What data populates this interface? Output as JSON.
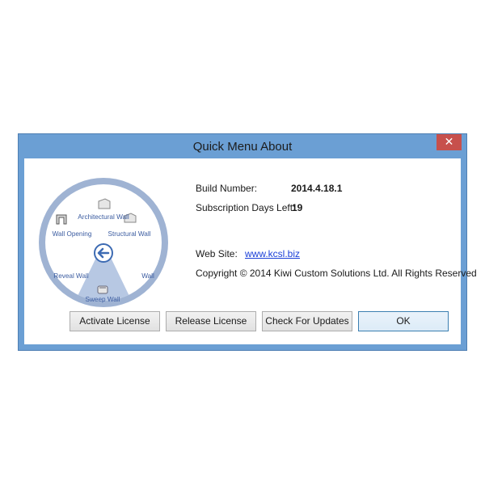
{
  "window": {
    "title": "Quick Menu About",
    "close_glyph": "✕"
  },
  "wheel": {
    "center_icon": "back-arrow-icon",
    "items": [
      {
        "label": "Architectural Wall",
        "icon": "wall-icon"
      },
      {
        "label": "Wall Opening",
        "icon": "wall-opening-icon"
      },
      {
        "label": "Structural Wall",
        "icon": "wall-icon"
      },
      {
        "label": "Reveal Wall",
        "icon": null
      },
      {
        "label": "Wall",
        "icon": null
      },
      {
        "label": "Sweep Wall",
        "icon": "sweep-wall-icon"
      }
    ],
    "colors": {
      "ring": "#9fb3d3",
      "highlight": "#b7c8e3",
      "arrow": "#3d6bb3"
    }
  },
  "info": {
    "build_label": "Build Number:",
    "build_value": "2014.4.18.1",
    "days_label": "Subscription Days Left:",
    "days_value": "19",
    "website_label": "Web Site:",
    "website_link": "www.kcsl.biz",
    "copyright": "Copyright © 2014 Kiwi Custom Solutions Ltd. All Rights Reserved"
  },
  "buttons": {
    "activate": "Activate License",
    "release": "Release License",
    "updates": "Check For Updates",
    "ok": "OK"
  },
  "colors": {
    "frame": "#6b9fd4",
    "close": "#c7504c",
    "link": "#1a3fd8"
  }
}
